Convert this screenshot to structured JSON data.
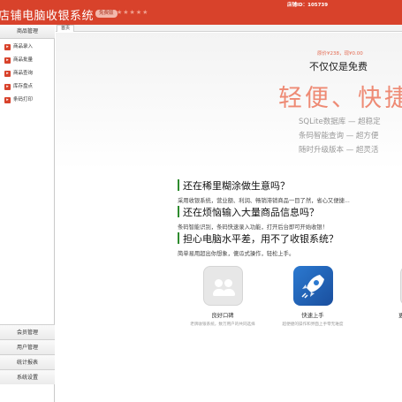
{
  "header": {
    "title": "店铺电脑收银系统",
    "version_badge": "免费版",
    "stars": "★★★★★",
    "shop_id": "店铺ID：105739"
  },
  "tabs": {
    "home": "首页"
  },
  "sidebar": {
    "top_group": "商品管理",
    "items": [
      {
        "label": "商品录入"
      },
      {
        "label": "商品批量"
      },
      {
        "label": "商品查询"
      },
      {
        "label": "库存盘点"
      },
      {
        "label": "条码打印"
      }
    ],
    "bottom_groups": [
      "会员管理",
      "用户管理",
      "统计报表",
      "系统设置"
    ]
  },
  "banner": {
    "price_line": "原价¥238，现¥0.00",
    "free_line": "不仅仅是免费",
    "slogan": "轻便、快捷",
    "features": [
      "SQLite数据库 — 超稳定",
      "条码智能查询 — 超方便",
      "随时升级版本 — 超灵活"
    ]
  },
  "qa": [
    {
      "heading": "还在稀里糊涂做生意吗？",
      "desc": "采用收银系统，营业额、利润、畅销滞销商品一目了然，省心又便捷..."
    },
    {
      "heading": "还在烦恼输入大量商品信息吗？",
      "desc": "条码智能识别，条码快速录入功能，打开后台即可开始收银！"
    },
    {
      "heading": "担心电脑水平差，用不了收银系统？",
      "desc": "简单易用超出你想象，傻瓜式操作，轻松上手。"
    }
  ],
  "cards": [
    {
      "title": "良好口碑",
      "sub": "老牌收银系统，数万用户的共同选择",
      "icon": "users-icon"
    },
    {
      "title": "快速上手",
      "sub": "超便捷的操作和界面上手零无难度",
      "icon": "rocket-icon"
    },
    {
      "title": "更多惊喜",
      "sub": "",
      "icon": "smile-icon"
    }
  ],
  "colors": {
    "brand": "#d8422b",
    "accent_green": "#2e8b2e",
    "slogan": "#ee8a74"
  }
}
